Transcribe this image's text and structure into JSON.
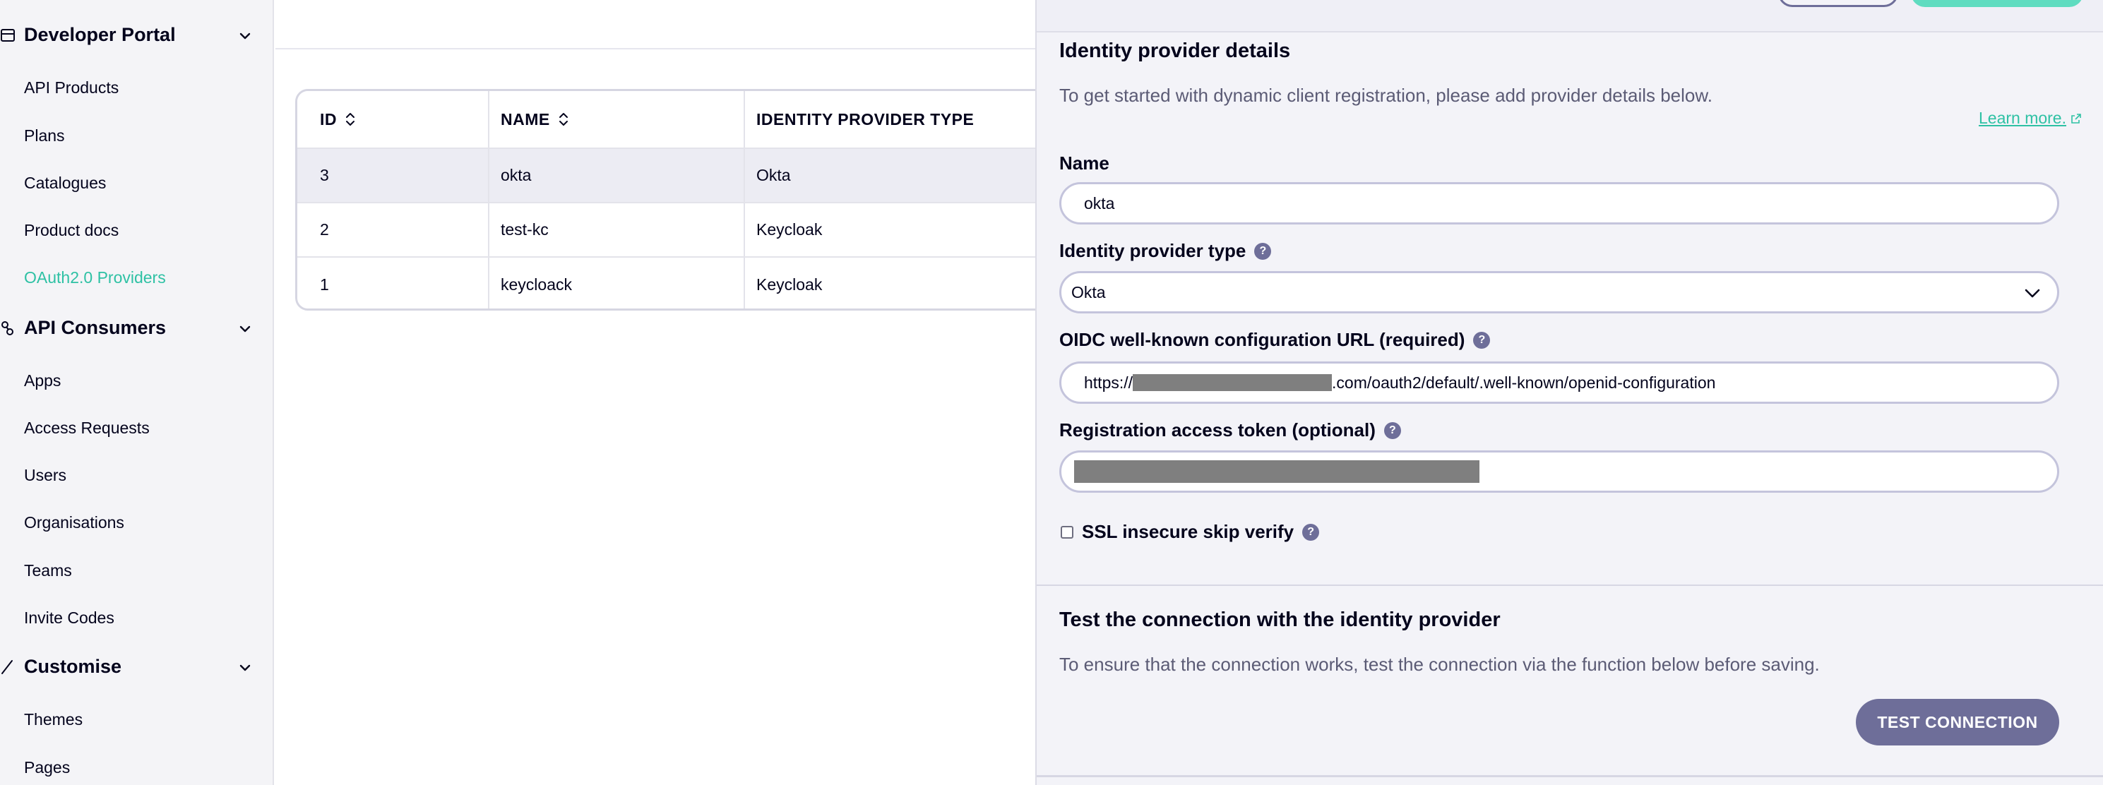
{
  "sidebar": {
    "sections": [
      {
        "title": "Developer Portal",
        "icon": "portal-icon",
        "items": [
          "API Products",
          "Plans",
          "Catalogues",
          "Product docs",
          "OAuth2.0 Providers"
        ],
        "active_item": "OAuth2.0 Providers"
      },
      {
        "title": "API Consumers",
        "icon": "consumers-icon",
        "items": [
          "Apps",
          "Access Requests",
          "Users",
          "Organisations",
          "Teams",
          "Invite Codes"
        ]
      },
      {
        "title": "Customise",
        "icon": "brush-icon",
        "items": [
          "Themes",
          "Pages"
        ]
      }
    ]
  },
  "table": {
    "columns": [
      "ID",
      "NAME",
      "IDENTITY PROVIDER TYPE"
    ],
    "rows": [
      [
        "3",
        "okta",
        "Okta"
      ],
      [
        "2",
        "test-kc",
        "Keycloak"
      ],
      [
        "1",
        "keycloack",
        "Keycloak"
      ]
    ]
  },
  "drawer": {
    "title": "Identity provider details",
    "subtitle": "To get started with dynamic client registration, please add provider details below.",
    "learn_more": "Learn more.",
    "name_label": "Name",
    "name_value": "okta",
    "type_label": "Identity provider type",
    "type_value": "Okta",
    "oidc_label": "OIDC well-known configuration URL (required)",
    "oidc_prefix": "https://",
    "oidc_suffix": ".com/oauth2/default/.well-known/openid-configuration",
    "token_label": "Registration access token (optional)",
    "ssl_label": "SSL insecure skip verify",
    "help_glyph": "?",
    "test_title": "Test the connection with the identity provider",
    "test_subtitle": "To ensure that the connection works, test the connection via the function below before saving.",
    "test_button": "TEST CONNECTION"
  },
  "colors": {
    "accent": "#2ec1a4",
    "primary_button": "#6e6e99",
    "text": "#03031c"
  }
}
